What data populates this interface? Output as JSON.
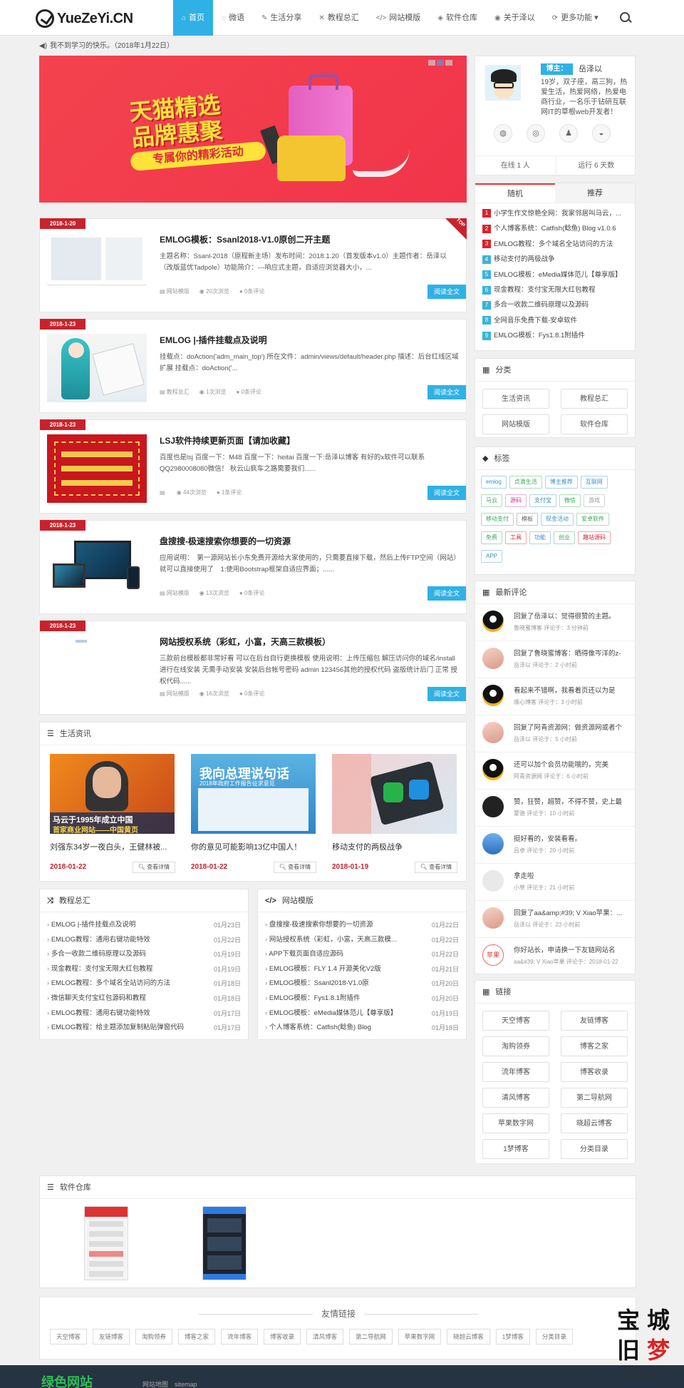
{
  "site": {
    "logo_text": "YueZeYi.CN"
  },
  "nav": [
    {
      "label": "首页",
      "icon": "home-icon",
      "glyph": "⌂"
    },
    {
      "label": "微语",
      "icon": "chat-icon",
      "glyph": "◌"
    },
    {
      "label": "生活分享",
      "icon": "edit-icon",
      "glyph": "✎"
    },
    {
      "label": "教程总汇",
      "icon": "shuffle-icon",
      "glyph": "✕"
    },
    {
      "label": "网站模版",
      "icon": "code-icon",
      "glyph": "</>"
    },
    {
      "label": "软件仓库",
      "icon": "box-icon",
      "glyph": "◈"
    },
    {
      "label": "关于泽以",
      "icon": "user-icon",
      "glyph": "◉"
    },
    {
      "label": "更多功能 ▾",
      "icon": "refresh-icon",
      "glyph": "⟳"
    }
  ],
  "notice": {
    "text": "我不到学习的快乐。（2018年1月22日）"
  },
  "banner": {
    "title_line1": "天猫精选",
    "title_line2": "品牌惠聚",
    "subtitle": "专属你的精彩活动"
  },
  "profile": {
    "role": "博主：",
    "name": "岳泽以",
    "bio": "19岁，双子座，高三狗，热爱生活，热爱网络，热爱电商行业，一名乐于钻研互联网IT的草根web开发者！",
    "online": "在线 1 人",
    "running": "运行 6 天数",
    "socials": [
      {
        "icon": "weibo-icon",
        "glyph": "◍"
      },
      {
        "icon": "wechat-icon",
        "glyph": "◎"
      },
      {
        "icon": "qq-icon",
        "glyph": "♟"
      },
      {
        "icon": "github-icon",
        "glyph": "◒"
      }
    ]
  },
  "random": {
    "tabs": [
      "随机",
      "推荐"
    ],
    "items": [
      {
        "n": "1",
        "text": "小学生作文惊艳全网：我家邻居叫马云，..."
      },
      {
        "n": "2",
        "text": "个人博客系统：Catfish(鲶鱼) Blog v1.0.6"
      },
      {
        "n": "3",
        "text": "EMLOG教程：多个域名全站访问的方法"
      },
      {
        "n": "4",
        "text": "移动支付的两极战争"
      },
      {
        "n": "5",
        "text": "EMLOG模板：eMedia媒体范儿【尊享版】"
      },
      {
        "n": "6",
        "text": "现金教程：支付宝无限大红包教程"
      },
      {
        "n": "7",
        "text": "多合一收款二维码原理以及源码"
      },
      {
        "n": "8",
        "text": "全网音乐免费下载-安卓软件"
      },
      {
        "n": "9",
        "text": "EMLOG模板：Fys1.8.1附插件"
      }
    ],
    "num_colors": [
      "#d9232c",
      "#d9232c",
      "#d9232c",
      "#3bb4d8",
      "#3bb4d8",
      "#3bb4d8",
      "#3bb4d8",
      "#3bb4d8",
      "#3bb4d8"
    ]
  },
  "categories": {
    "title": "分类",
    "items": [
      "生活资讯",
      "教程总汇",
      "网站模版",
      "软件仓库"
    ]
  },
  "tags": {
    "title": "标签",
    "items": [
      {
        "t": "emlog",
        "c": "#3a8ec8"
      },
      {
        "t": "点滴生活",
        "c": "#3aa55a"
      },
      {
        "t": "博主推荐",
        "c": "#3a8ec8"
      },
      {
        "t": "互联网",
        "c": "#3a8ec8"
      },
      {
        "t": "马云",
        "c": "#3aa55a"
      },
      {
        "t": "源码",
        "c": "#c83aa0"
      },
      {
        "t": "支付宝",
        "c": "#3a8ec8"
      },
      {
        "t": "微信",
        "c": "#3aa55a"
      },
      {
        "t": "游戏",
        "c": "#999999"
      },
      {
        "t": "移动支付",
        "c": "#3aa55a"
      },
      {
        "t": "模板",
        "c": "#666666"
      },
      {
        "t": "现金活动",
        "c": "#3a8ec8"
      },
      {
        "t": "安卓软件",
        "c": "#3aa55a"
      },
      {
        "t": "免费",
        "c": "#3aa55a"
      },
      {
        "t": "工具",
        "c": "#d9232c"
      },
      {
        "t": "功能",
        "c": "#3a8ec8"
      },
      {
        "t": "创业",
        "c": "#3aa55a"
      },
      {
        "t": "趣站源码",
        "c": "#d9232c"
      },
      {
        "t": "APP",
        "c": "#3a8ec8"
      }
    ]
  },
  "comments": {
    "title": "最新评论",
    "items": [
      {
        "text": "回复了岳泽以：觉得很赞的主题。",
        "meta": "鲁晓蜜博客 评论于：3 分钟前",
        "av": "qq"
      },
      {
        "text": "回复了鲁晓蜜博客：晒得像岑洋的z-",
        "meta": "岳泽以 评论于：2 小时前",
        "av": "anime"
      },
      {
        "text": "看起来不错啊，我看着页还以为是",
        "meta": "顺心博客 评论于：3 小时前",
        "av": "qq"
      },
      {
        "text": "回复了阿青资源网：做资源网或者个",
        "meta": "岳泽以 评论于：5 小时前",
        "av": "anime"
      },
      {
        "text": "还可以加个会员功能哦的，完美",
        "meta": "阿青资源网 评论于：6 小时前",
        "av": "qq"
      },
      {
        "text": "赞，狂赞，超赞，不得不赞，史上最",
        "meta": "蒙骆 评论于：10 小时前",
        "av": "dark"
      },
      {
        "text": "挺好看的，安装看看。",
        "meta": "吕卓 评论于：20 小时前",
        "av": "blue"
      },
      {
        "text": "拿走啦",
        "meta": "小草 评论于：21 小时前",
        "av": "plain"
      },
      {
        "text": "回复了aa&amp;#39; V Xiao苹果：...",
        "meta": "岳泽以 评论于：23 小时前",
        "av": "anime"
      },
      {
        "text": "你好站长，申请换一下友链网站名",
        "meta": "aa&#39; V Xiao苹果 评论于：2018-01-22",
        "av": "apple"
      }
    ]
  },
  "links": {
    "title": "链接",
    "items": [
      "天空博客",
      "友链博客",
      "淘购领券",
      "博客之家",
      "流年博客",
      "博客收录",
      "清风博客",
      "第二导航网",
      "苹果数字网",
      "晓超云博客",
      "1梦博客",
      "分类目录"
    ]
  },
  "posts": [
    {
      "date": "2018-1-20",
      "title": "EMLOG模板：Ssanl2018-V1.0原创二开主题",
      "excerpt": "主题名称：Ssanl-2018（原程新主场）发布时间：2018.1.20（首发版本v1.0）主题作者：岳泽以（改版蓝优Tadpole）功能简介：---响应式主题，自适应浏览器大小，...",
      "cat": "网站模版",
      "views": "20次浏览",
      "cmts": "0条评论",
      "read": "阅读全文",
      "top": "TOP",
      "thumb": "web"
    },
    {
      "date": "2018-1-23",
      "title": "EMLOG |-插件挂载点及说明",
      "excerpt": "挂载点：doAction('adm_main_top') 所在文件：admin/views/default/header.php 描述：后台红线区域扩展 挂载点：doAction('...",
      "cat": "教程总汇",
      "views": "1次浏览",
      "cmts": "0条评论",
      "read": "阅读全文",
      "thumb": "miku"
    },
    {
      "date": "2018-1-23",
      "title": "LSJ软件持续更新页面【请加收藏】",
      "excerpt": "百度也是lsj 百度一下：M48 百度一下：heitai 百度一下:岳泽以博客 有好的x软件可以联系QQ2980008080微信！ 秋云山疯车之路需要我们......",
      "cat": "",
      "views": "44次浏览",
      "cmts": "1条评论",
      "read": "阅读全文",
      "thumb": "red"
    },
    {
      "date": "2018-1-23",
      "title": "盘搜搜-极速搜索你想要的一切资源",
      "excerpt": "应用说明：　第一源网站长小东免费开源给大家使用的，只需要直接下载，然后上传FTP空间（网站）就可以直接使用了　1:使用Bootstrap框架自适应界面；......",
      "cat": "网站模版",
      "views": "13次浏览",
      "cmts": "0条评论",
      "read": "阅读全文",
      "thumb": "devices"
    },
    {
      "date": "2018-1-23",
      "title": "网站授权系统（彩虹，小富，天高三款模板）",
      "excerpt": "三款前台模板都非常好看 可以在后台自行更换模板 使用说明：上传压缩包 解压访问你的域名/install 进行在线安装 无需手动安装 安装后台帐号密码 admin 123456其他的授权代码 盗版统计后门 正常 授权代码......",
      "cat": "网站模版",
      "views": "16次浏览",
      "cmts": "0条评论",
      "read": "阅读全文",
      "thumb": "blank"
    }
  ],
  "life": {
    "title": "生活资讯",
    "items": [
      {
        "title": "刘强东34岁一夜白头，王健林被...",
        "date": "2018-01-22",
        "more": "查看详情",
        "img": "ma"
      },
      {
        "title": "你的意见可能影响13亿中国人！",
        "date": "2018-01-22",
        "more": "查看详情",
        "img": "poster",
        "img_line1": "我向总理说句话",
        "img_line2": "2018年政府工作报告征求意见"
      },
      {
        "title": "移动支付的两极战争",
        "date": "2018-01-19",
        "more": "查看详情",
        "img": "pay"
      }
    ],
    "ma_caption1": "马云于1995年成立中国",
    "ma_caption2": "首家商业网站——中国黄页"
  },
  "tutorials": {
    "title": "教程总汇",
    "items": [
      {
        "t": "EMLOG |-插件挂载点及说明",
        "d": "01月23日"
      },
      {
        "t": "EMLOG教程：通用右键功能特效",
        "d": "01月22日"
      },
      {
        "t": "多合一收款二维码原理以及源码",
        "d": "01月19日"
      },
      {
        "t": "现金教程：支付宝无限大红包教程",
        "d": "01月19日"
      },
      {
        "t": "EMLOG教程：多个域名全站访问的方法",
        "d": "01月18日"
      },
      {
        "t": "微信聊天支付宝红包源码和教程",
        "d": "01月18日"
      },
      {
        "t": "EMLOG教程：通用右键功能特效",
        "d": "01月17日"
      },
      {
        "t": "EMLOG教程：给主题添加复制粘贴弹窗代码",
        "d": "01月17日"
      }
    ]
  },
  "templates": {
    "title": "网站模版",
    "items": [
      {
        "t": "盘搜搜-极速搜索你想要的一切资源",
        "d": "01月22日"
      },
      {
        "t": "网站授权系统（彩虹，小富，天高三款模...",
        "d": "01月22日"
      },
      {
        "t": "APP下载页面自适应源码",
        "d": "01月22日"
      },
      {
        "t": "EMLOG模板：FLY 1.4 开源美化V2版",
        "d": "01月21日"
      },
      {
        "t": "EMLOG模板：Ssanl2018-V1.0原",
        "d": "01月20日"
      },
      {
        "t": "EMLOG模板：Fys1.8.1附插件",
        "d": "01月20日"
      },
      {
        "t": "EMLOG模板：eMedia媒体范儿【尊享版】",
        "d": "01月19日"
      },
      {
        "t": "个人博客系统：Catfish(鲶鱼) Blog",
        "d": "01月18日"
      }
    ]
  },
  "software": {
    "title": "软件仓库"
  },
  "friends": {
    "title": "友情链接",
    "items": [
      "天空博客",
      "友链博客",
      "淘购领券",
      "博客之家",
      "流年博客",
      "博客收录",
      "清风博客",
      "第二导航网",
      "苹果数字网",
      "晓超云博客",
      "1梦博客",
      "分类目录"
    ]
  },
  "footer": {
    "logo": "绿色网站",
    "sitemap": "网站地图　sitemap"
  },
  "watermark": {
    "c1": "宝",
    "c2": "城",
    "c3": "旧",
    "c4": "梦",
    "url": "kdblog.cn"
  }
}
